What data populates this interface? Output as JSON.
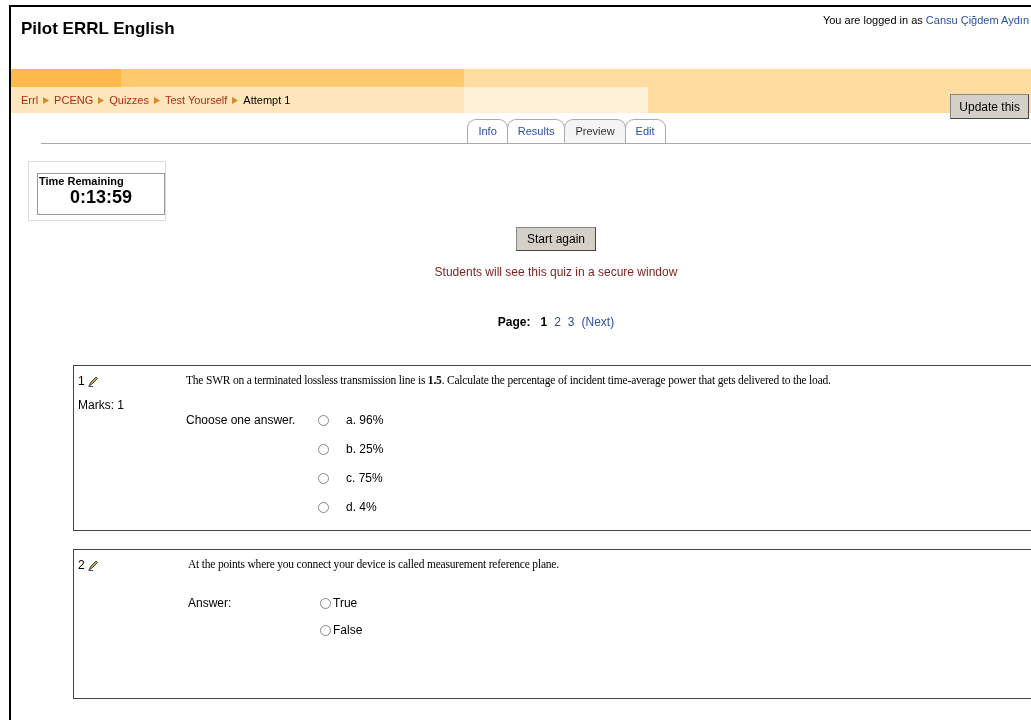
{
  "header": {
    "title": "Pilot ERRL English",
    "login_prefix": "You are logged in as",
    "user": "Cansu Çiğdem Aydın"
  },
  "breadcrumb": [
    "Errl",
    "PCENG",
    "Quizzes",
    "Test Yourself",
    "Attempt 1"
  ],
  "update_button": "Update this",
  "tabs": [
    {
      "label": "Info",
      "selected": false
    },
    {
      "label": "Results",
      "selected": false
    },
    {
      "label": "Preview",
      "selected": true
    },
    {
      "label": "Edit",
      "selected": false
    }
  ],
  "timer": {
    "label": "Time Remaining",
    "value": "0:13:59"
  },
  "start_button": "Start again",
  "notice": "Students will see this quiz in a secure window",
  "pager": {
    "label": "Page:",
    "pages": [
      {
        "label": "1",
        "selected": true
      },
      {
        "label": "2",
        "selected": false
      },
      {
        "label": "3",
        "selected": false
      }
    ],
    "next": "(Next)"
  },
  "questions": [
    {
      "number": "1",
      "marks": "Marks: 1",
      "text": "The SWR on a terminated lossless transmission line is **1.5**. Calculate the percentage of incident time-average power that gets delivered to the load.",
      "prompt": "Choose one answer.",
      "kind": "multichoice",
      "options": [
        {
          "label": "a. 96%",
          "selected": false
        },
        {
          "label": "b. 25%",
          "selected": false
        },
        {
          "label": "c. 75%",
          "selected": false
        },
        {
          "label": "d. 4%",
          "selected": false
        }
      ]
    },
    {
      "number": "2",
      "text": "At the points where you connect your device is called measurement reference plane.",
      "prompt": "Answer:",
      "kind": "truefalse",
      "options": [
        {
          "label": "True",
          "selected": false
        },
        {
          "label": "False",
          "selected": false
        }
      ]
    }
  ]
}
